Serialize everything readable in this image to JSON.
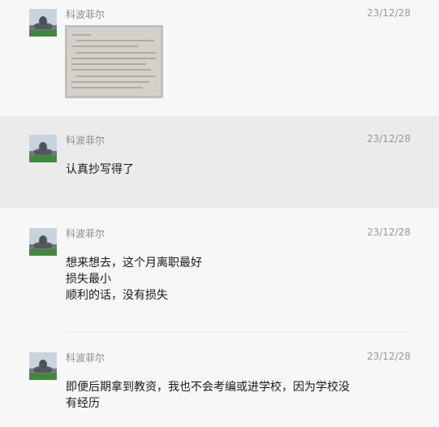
{
  "messages": [
    {
      "author": "科波菲尔",
      "date": "23/12/28",
      "attachment": "handwritten-notebook-photo",
      "lines": []
    },
    {
      "author": "科波菲尔",
      "date": "23/12/28",
      "lines": [
        "认真抄写得了"
      ]
    },
    {
      "author": "科波菲尔",
      "date": "23/12/28",
      "lines": [
        "想来想去，这个月离职最好",
        "损失最小",
        "顺利的话，没有损失"
      ]
    },
    {
      "author": "科波菲尔",
      "date": "23/12/28",
      "lines": [
        "即便后期拿到教资，我也不会考编或进学校，因为学校没",
        "有经历"
      ]
    }
  ],
  "colors": {
    "background": "#f7f7f7",
    "highlight": "#ebebeb",
    "author_text": "#8a8a8a",
    "message_text": "#1a1a1a"
  }
}
